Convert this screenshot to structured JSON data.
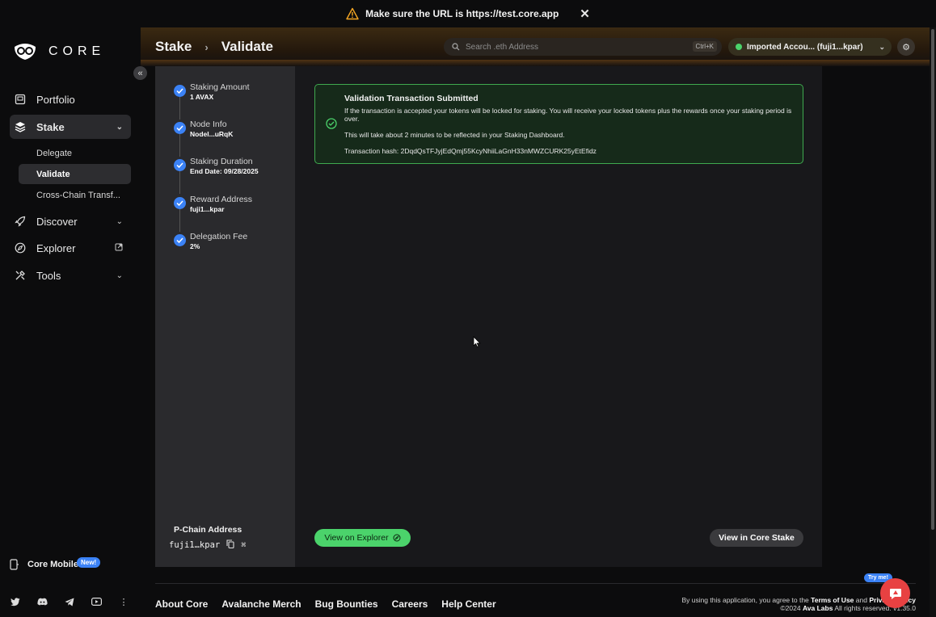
{
  "banner": {
    "text": "Make sure the URL is",
    "url": "https://test.core.app"
  },
  "app": {
    "logo_text": "CORE"
  },
  "sidebar": {
    "items": [
      {
        "label": "Portfolio"
      },
      {
        "label": "Stake"
      },
      {
        "label": "Discover"
      },
      {
        "label": "Explorer"
      },
      {
        "label": "Tools"
      }
    ],
    "stake_sub": [
      {
        "label": "Delegate"
      },
      {
        "label": "Validate"
      },
      {
        "label": "Cross-Chain Transf..."
      }
    ],
    "mobile_label": "Core Mobile",
    "new_badge": "New!"
  },
  "header": {
    "crumb1": "Stake",
    "crumb2": "Validate",
    "search_placeholder": "Search .eth Address",
    "search_shortcut": "Ctrl+K",
    "account_label": "Imported Accou... (fuji1...kpar)"
  },
  "steps": [
    {
      "title": "Staking Amount",
      "value": "1 AVAX"
    },
    {
      "title": "Node Info",
      "value": "NodeI...uRqK"
    },
    {
      "title": "Staking Duration",
      "value": "End Date: 09/28/2025"
    },
    {
      "title": "Reward Address",
      "value": "fuji1...kpar"
    },
    {
      "title": "Delegation Fee",
      "value": "2%"
    }
  ],
  "pchain": {
    "label": "P-Chain Address",
    "value": "fuji1…kpar"
  },
  "success": {
    "title": "Validation Transaction Submitted",
    "line1": "If the transaction is accepted your tokens will be locked for staking. You will receive your locked tokens plus the rewards once your staking period is over.",
    "line2": "This will take about 2 minutes to be reflected in your Staking Dashboard.",
    "line3": "Transaction hash: 2DqdQsTFJyjEdQmj55KcyNhiiLaGnH33nMWZCURK25yEtEfidz"
  },
  "buttons": {
    "explorer": "View on Explorer",
    "core_stake": "View in Core Stake"
  },
  "footer": {
    "links": [
      "About Core",
      "Avalanche Merch",
      "Bug Bounties",
      "Careers",
      "Help Center"
    ],
    "legal_pre": "By using this application, you agree to the",
    "terms": "Terms of Use",
    "and": "and",
    "privacy": "Privacy Policy",
    "copyright": "©2024",
    "company": "Ava Labs",
    "rights": "All rights reserved.",
    "version": "v1.35.0"
  },
  "chat": {
    "try_me": "Try me!"
  },
  "colors": {
    "accent_green": "#4bd36b",
    "accent_blue": "#3b82f6",
    "success_border": "#3fa94f",
    "chat_red": "#e84142"
  }
}
